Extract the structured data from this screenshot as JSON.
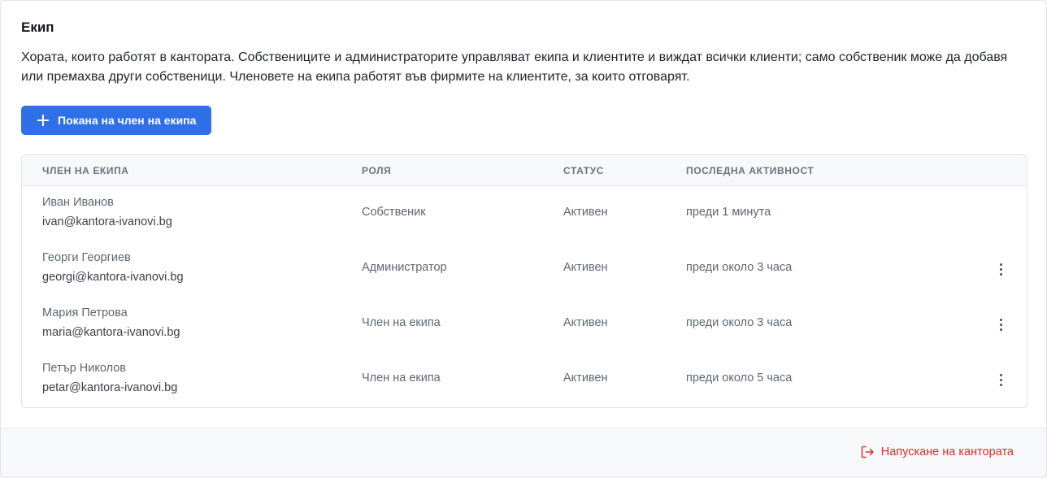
{
  "page": {
    "title": "Екип",
    "description": "Хората, които работят в кантората. Собствениците и администраторите управляват екипа и клиентите и виждат всички клиенти; само собственик може да добавя или премахва други собственици. Членовете на екипа работят във фирмите на клиентите, за които отговарят."
  },
  "actions": {
    "invite_label": "Покана на член на екипа",
    "invite_icon": "plus-icon"
  },
  "table": {
    "columns": {
      "member": "Член на екипа",
      "role": "Роля",
      "status": "Статус",
      "last_activity": "Последна активност"
    },
    "rows": [
      {
        "name": "Иван Иванов",
        "email": "ivan@kantora-ivanovi.bg",
        "role": "Собственик",
        "status": "Активен",
        "last_activity": "преди 1 минута",
        "has_menu": false
      },
      {
        "name": "Георги Георгиев",
        "email": "georgi@kantora-ivanovi.bg",
        "role": "Администратор",
        "status": "Активен",
        "last_activity": "преди около 3 часа",
        "has_menu": true
      },
      {
        "name": "Мария Петрова",
        "email": "maria@kantora-ivanovi.bg",
        "role": "Член на екипа",
        "status": "Активен",
        "last_activity": "преди около 3 часа",
        "has_menu": true
      },
      {
        "name": "Петър Николов",
        "email": "petar@kantora-ivanovi.bg",
        "role": "Член на екипа",
        "status": "Активен",
        "last_activity": "преди около 5 часа",
        "has_menu": true
      }
    ]
  },
  "footer": {
    "leave_label": "Напускане на кантората",
    "leave_icon": "logout-icon"
  },
  "colors": {
    "accent": "#2f6fe8",
    "danger": "#dc2f2f"
  }
}
